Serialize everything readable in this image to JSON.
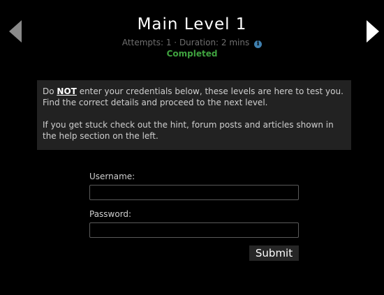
{
  "header": {
    "title": "Main Level 1",
    "attempts": "Attempts: 1",
    "separator": "·",
    "duration": "Duration: 2 mins",
    "info_icon": "info-icon",
    "status": "Completed",
    "status_color": "#3fa33f"
  },
  "navigation": {
    "prev_icon": "chevron-left-icon",
    "next_icon": "chevron-right-icon"
  },
  "notice": {
    "line1_prefix": "Do",
    "line1_emphasis": "NOT",
    "line1_suffix": "enter your credentials below, these levels are here to test you. Find the correct details and proceed to the next level.",
    "line2": "If you get stuck check out the hint, forum posts and articles shown in the help section on the left."
  },
  "form": {
    "username_label": "Username:",
    "username_value": "",
    "password_label": "Password:",
    "password_value": "",
    "submit_label": "Submit"
  },
  "colors": {
    "background": "#000000",
    "panel": "#222222",
    "info_icon": "#3f7fae"
  }
}
